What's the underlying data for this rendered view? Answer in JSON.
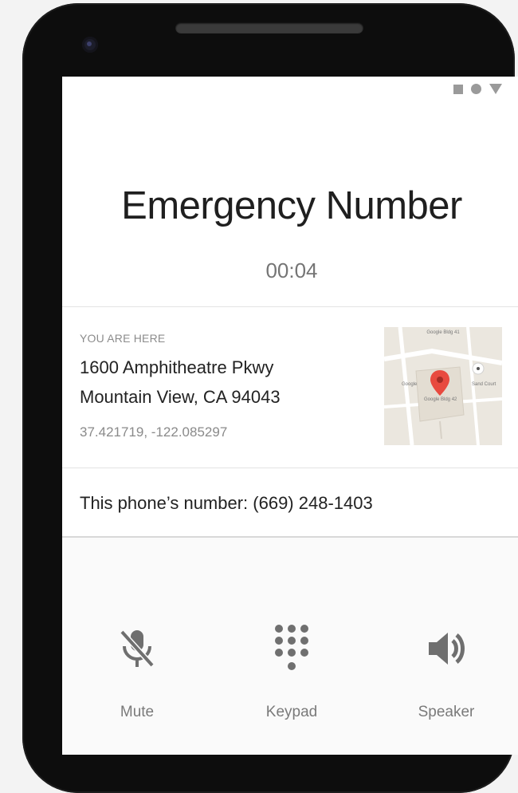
{
  "status_bar": {
    "icons": [
      "square-icon",
      "circle-icon",
      "triangle-icon"
    ]
  },
  "call": {
    "title": "Emergency Number",
    "timer": "00:04"
  },
  "location": {
    "label": "YOU ARE HERE",
    "address_line1": "1600 Amphitheatre Pkwy",
    "address_line2": "Mountain View, CA 94043",
    "coordinates": "37.421719, -122.085297",
    "map": {
      "label_top": "Google Bldg 41",
      "label_left": "Google",
      "label_right": "Sand Court",
      "label_bottom": "Google Bldg 42",
      "pin_color": "#e84a3f"
    }
  },
  "phone_number": {
    "text": "This phone’s number: (669) 248-1403"
  },
  "controls": [
    {
      "label": "Mute",
      "icon": "mute-microphone-icon"
    },
    {
      "label": "Keypad",
      "icon": "dialpad-icon"
    },
    {
      "label": "Speaker",
      "icon": "speaker-icon"
    }
  ],
  "colors": {
    "icon_gray": "#6f6f6f",
    "text_dark": "#222222",
    "text_muted": "#8a8a8a"
  }
}
